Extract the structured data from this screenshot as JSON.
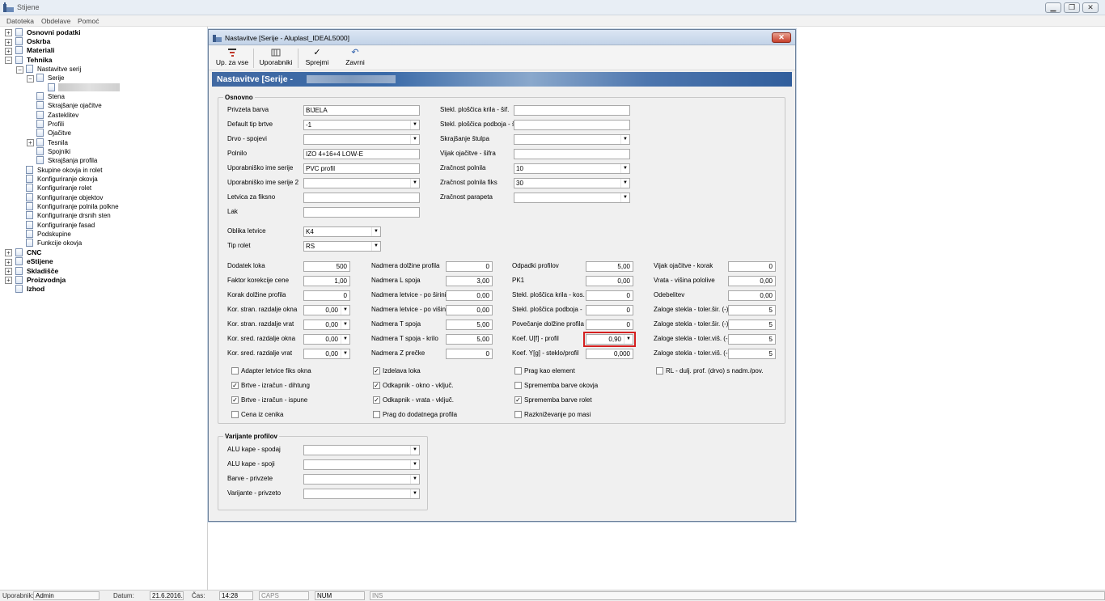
{
  "app": {
    "title": "Stijene"
  },
  "menu": [
    "Datoteka",
    "Obdelave",
    "Pomoć"
  ],
  "tree": {
    "roots": [
      "Osnovni podatki",
      "Oskrba",
      "Materiali",
      "Tehnika"
    ],
    "tehnika_children": [
      "Nastavitve serij"
    ],
    "nastavitve_children": [
      "Serije"
    ],
    "serije_children": [
      "Stena",
      "Skrajšanje ojačitve",
      "Zasteklitev",
      "Profili",
      "Ojačitve",
      "Tesnila",
      "Spojniki",
      "Skrajšanja profila"
    ],
    "tehnika_items": [
      "Skupine okovja in rolet",
      "Konfiguriranje okovja",
      "Konfiguriranje rolet",
      "Konfiguriranje objektov",
      "Konfiguriranje polnila polkne",
      "Konfiguriranje drsnih sten",
      "Konfiguriranje fasad",
      "Podskupine",
      "Funkcije okovja"
    ],
    "roots2": [
      "CNC",
      "eStijene",
      "Skladišče",
      "Proizvodnja",
      "Izhod"
    ]
  },
  "dialog": {
    "title": "Nastavitve  [Serije - Aluplast_IDEAL5000]",
    "close": "✕",
    "toolbar": [
      {
        "label": "Up. za vse",
        "icon": "filter-icon"
      },
      {
        "label": "Uporabniki",
        "icon": "users-icon"
      },
      {
        "label": "Sprejmi",
        "icon": "check-icon"
      },
      {
        "label": "Zavrni",
        "icon": "undo-icon"
      }
    ],
    "banner": "Nastavitve  [Serije -",
    "group_osnovno": "Osnovno",
    "group_varijante": "Varijante profilov"
  },
  "osnovno_left": [
    {
      "label": "Privzeta barva",
      "value": "BIJELA",
      "type": "text"
    },
    {
      "label": "Default tip brtve",
      "value": "-1",
      "type": "combo"
    },
    {
      "label": "Drvo - spojevi",
      "value": "",
      "type": "combo"
    },
    {
      "label": "Polnilo",
      "value": "IZO 4+16+4 LOW-E",
      "type": "text"
    },
    {
      "label": "Uporabniško ime serije",
      "value": "PVC profil",
      "type": "text"
    },
    {
      "label": "Uporabniško ime serije 2",
      "value": "",
      "type": "combo"
    },
    {
      "label": "Letvica za fiksno",
      "value": "",
      "type": "text"
    },
    {
      "label": "Lak",
      "value": "",
      "type": "text"
    }
  ],
  "osnovno_right": [
    {
      "label": "Stekl. ploščica krila - šif.",
      "value": "",
      "type": "text"
    },
    {
      "label": "Stekl. ploščica podboja - š",
      "value": "",
      "type": "text"
    },
    {
      "label": "Skrajšanje štulpa",
      "value": "",
      "type": "combo"
    },
    {
      "label": "Vijak ojačitve - šifra",
      "value": "",
      "type": "text"
    },
    {
      "label": "Zračnost polnila",
      "value": "10",
      "type": "combo"
    },
    {
      "label": "Zračnost polnila fiks",
      "value": "30",
      "type": "combo"
    },
    {
      "label": "Zračnost parapeta",
      "value": "",
      "type": "combo"
    }
  ],
  "oblika": {
    "label": "Oblika letvice",
    "value": "K4"
  },
  "tip_rolet": {
    "label": "Tip rolet",
    "value": "RS"
  },
  "num_col1": [
    {
      "label": "Dodatek loka",
      "value": "500",
      "type": "text"
    },
    {
      "label": "Faktor korekcije cene",
      "value": "1,00",
      "type": "text"
    },
    {
      "label": "Korak dolžine profila",
      "value": "0",
      "type": "text"
    },
    {
      "label": "Kor. stran. razdalje okna",
      "value": "0,00",
      "type": "combo"
    },
    {
      "label": "Kor. stran. razdalje vrat",
      "value": "0,00",
      "type": "combo"
    },
    {
      "label": "Kor. sred. razdalje okna",
      "value": "0,00",
      "type": "combo"
    },
    {
      "label": "Kor. sred. razdalje vrat",
      "value": "0,00",
      "type": "combo"
    }
  ],
  "num_col2": [
    {
      "label": "Nadmera dolžine profila",
      "value": "0"
    },
    {
      "label": "Nadmera L spoja",
      "value": "3,00"
    },
    {
      "label": "Nadmera letvice - po širini",
      "value": "0,00"
    },
    {
      "label": "Nadmera letvice - po višini",
      "value": "0,00"
    },
    {
      "label": "Nadmera T spoja",
      "value": "5,00"
    },
    {
      "label": "Nadmera T spoja - krilo",
      "value": "5,00"
    },
    {
      "label": "Nadmera Z prečke",
      "value": "0"
    }
  ],
  "num_col3": [
    {
      "label": "Odpadki profilov",
      "value": "5,00",
      "type": "text"
    },
    {
      "label": "PK1",
      "value": "0,00",
      "type": "text"
    },
    {
      "label": "Stekl. ploščica krila - kos.",
      "value": "0",
      "type": "text"
    },
    {
      "label": "Stekl. ploščica podboja -",
      "value": "0",
      "type": "text"
    },
    {
      "label": "Povečanje dolžine profila",
      "value": "0",
      "type": "text"
    },
    {
      "label": "Koef. U[f] - profil",
      "value": "0,90",
      "type": "combo"
    },
    {
      "label": "Koef. Y[g] - steklo/profil",
      "value": "0,000",
      "type": "text"
    }
  ],
  "num_col4": [
    {
      "label": "Vijak ojačitve - korak",
      "value": "0"
    },
    {
      "label": "Vrata - višina pololive",
      "value": "0,00"
    },
    {
      "label": "Odebelitev",
      "value": "0,00"
    },
    {
      "label": "Zaloge stekla - toler.šir. (-)",
      "value": "5"
    },
    {
      "label": "Zaloge stekla - toler.šir. (-)",
      "value": "5"
    },
    {
      "label": "Zaloge stekla - toler.viš. (-)",
      "value": "5"
    },
    {
      "label": "Zaloge stekla - toler.viš. (-)",
      "value": "5"
    }
  ],
  "checks": [
    [
      {
        "label": "Adapter letvice fiks okna",
        "checked": false
      },
      {
        "label": "Brtve - izračun - dihtung",
        "checked": true
      },
      {
        "label": "Brtve - izračun - ispune",
        "checked": true
      },
      {
        "label": "Cena iz cenika",
        "checked": false
      }
    ],
    [
      {
        "label": "Izdelava loka",
        "checked": true
      },
      {
        "label": "Odkapnik - okno - vključ.",
        "checked": true
      },
      {
        "label": "Odkapnik - vrata - vključ.",
        "checked": true
      },
      {
        "label": "Prag do dodatnega profila",
        "checked": false
      }
    ],
    [
      {
        "label": "Prag kao element",
        "checked": false
      },
      {
        "label": "Sprememba barve okovja",
        "checked": false
      },
      {
        "label": "Sprememba barve rolet",
        "checked": true
      },
      {
        "label": "Razkniževanje po masi",
        "checked": false
      }
    ],
    [
      {
        "label": "RL - dulj. prof. (drvo) s nadm./pov.",
        "checked": false
      }
    ]
  ],
  "varijante": [
    {
      "label": "ALU kape - spodaj",
      "value": ""
    },
    {
      "label": "ALU kape - spoji",
      "value": ""
    },
    {
      "label": "Barve - privzete",
      "value": ""
    },
    {
      "label": "Varijante - privzeto",
      "value": ""
    }
  ],
  "status": {
    "user_label": "Uporabnik:",
    "user": "Admin",
    "date_label": "Datum:",
    "date": "21.6.2016.",
    "time_label": "Čas:",
    "time": "14:28",
    "caps": "CAPS",
    "num": "NUM",
    "ins": "INS"
  },
  "colors": {
    "banner": "#3a6aa8",
    "highlight": "#d42020"
  }
}
